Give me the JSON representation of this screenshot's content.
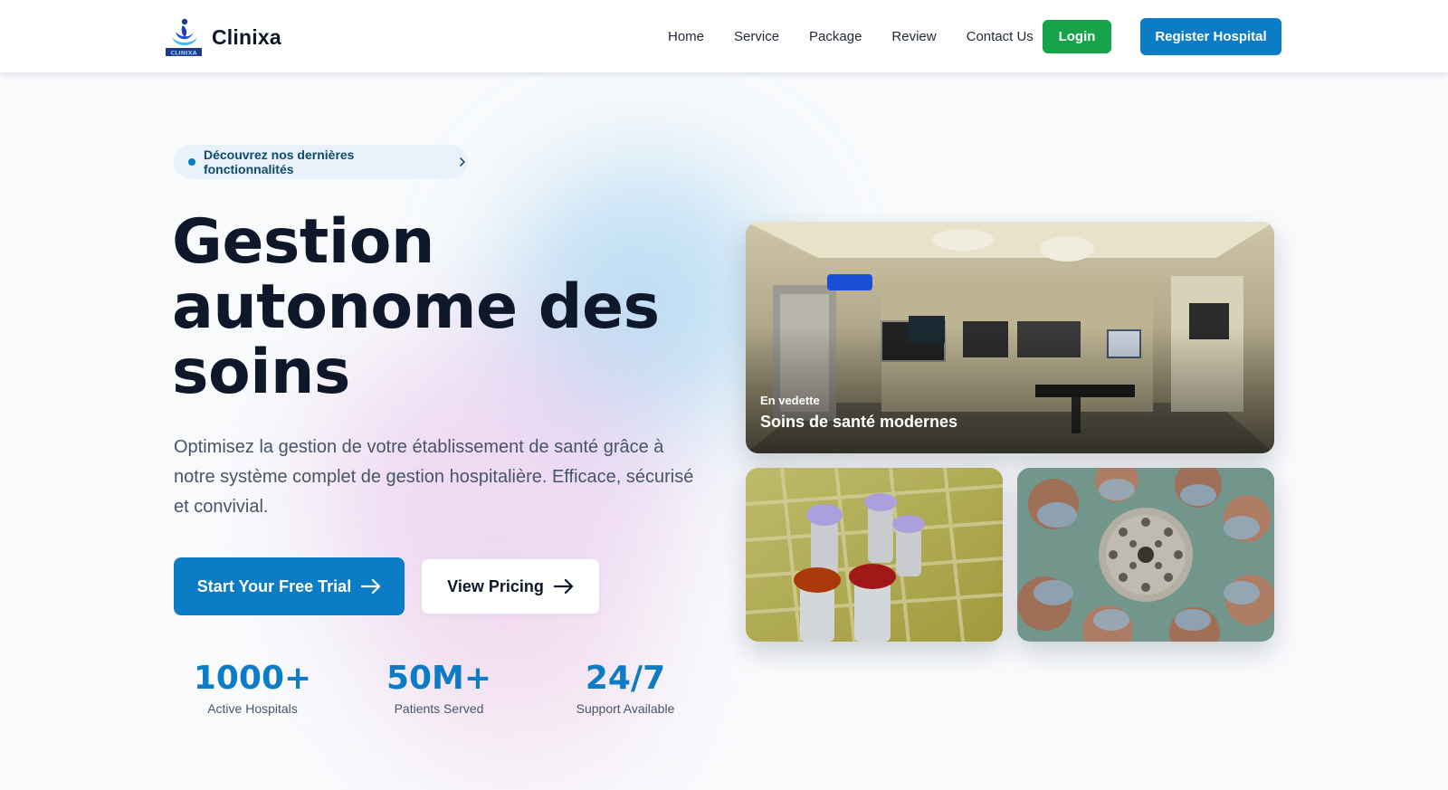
{
  "brand": {
    "name": "Clinixa",
    "logo_caption": "CLINIXA",
    "primary_color": "#0b7cc5",
    "success_color": "#16a34a"
  },
  "nav": {
    "links": [
      "Home",
      "Service",
      "Package",
      "Review",
      "Contact Us"
    ],
    "login_label": "Login",
    "register_label": "Register Hospital"
  },
  "hero": {
    "announcement": "Découvrez nos dernières fonctionnalités",
    "title_lines": [
      "Gestion",
      "autonome des",
      "soins"
    ],
    "description": "Optimisez la gestion de votre établissement de santé grâce à notre système complet de gestion hospitalière. Efficace, sécurisé et convivial.",
    "primary_cta": "Start Your Free Trial",
    "secondary_cta": "View Pricing"
  },
  "stats": [
    {
      "value": "1000+",
      "label": "Active Hospitals"
    },
    {
      "value": "50M+",
      "label": "Patients Served"
    },
    {
      "value": "24/7",
      "label": "Support Available"
    }
  ],
  "gallery": {
    "featured_kicker": "En vedette",
    "featured_title": "Soins de santé modernes"
  }
}
